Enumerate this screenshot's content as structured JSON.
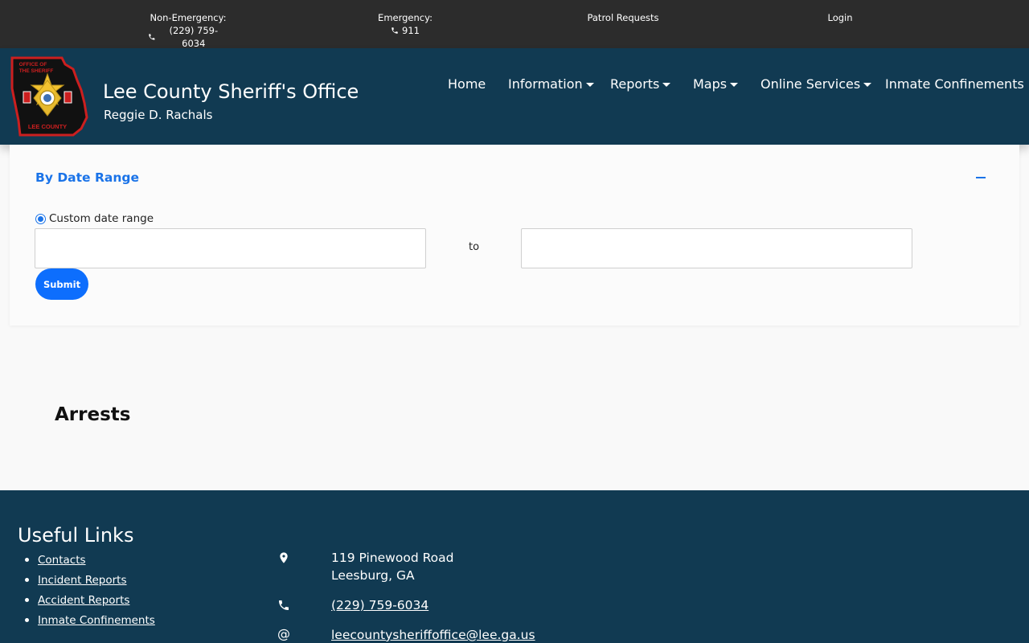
{
  "topbar": {
    "non_emergency_label": "Non-Emergency:",
    "non_emergency_phone": "(229) 759-6034",
    "emergency_label": "Emergency:",
    "emergency_phone": "911",
    "patrol_requests": "Patrol Requests",
    "login": "Login",
    "phone_icon": "phone-icon"
  },
  "header": {
    "title": "Lee County Sheriff's Office",
    "subtitle": "Reggie D. Rachals",
    "logo": {
      "icon": "sheriff-badge-logo",
      "text_top": "OFFICE OF THE SHERIFF",
      "text_bottom": "LEE COUNTY",
      "badge_text": "SHERIFF LEE COUNTY",
      "colors": {
        "outline": "#cc1f1f",
        "fill": "#111111",
        "star": "#f2c230"
      }
    },
    "nav": [
      {
        "label": "Home",
        "has_dropdown": false
      },
      {
        "label": "Information",
        "has_dropdown": true
      },
      {
        "label": "Reports",
        "has_dropdown": true
      },
      {
        "label": "Maps",
        "has_dropdown": true
      },
      {
        "label": "Online Services",
        "has_dropdown": true
      },
      {
        "label": "Inmate Confinements",
        "has_dropdown": false
      }
    ]
  },
  "filter": {
    "title": "By Date Range",
    "collapse_icon": "minus-icon",
    "radio_label": "Custom date range",
    "radio_checked": true,
    "start_date_value": "",
    "to_label": "to",
    "end_date_value": "",
    "submit_label": "Submit"
  },
  "main": {
    "section_heading": "Arrests"
  },
  "footer": {
    "title": "Useful Links",
    "links": [
      "Contacts",
      "Incident Reports",
      "Accident Reports",
      "Inmate Confinements"
    ],
    "address_line1": "119 Pinewood Road",
    "address_line2": "Leesburg, GA",
    "phone": "(229) 759-6034",
    "email_symbol": "@",
    "email": "leecountysheriffoffice@lee.ga.us",
    "icons": {
      "address": "map-pin-icon",
      "phone": "phone-icon",
      "email": "at-sign-icon"
    }
  },
  "colors": {
    "topbar_bg": "#2c2c2c",
    "header_bg": "#113a52",
    "accent_blue": "#1a73e8",
    "button_blue": "#0d6efd",
    "page_bg": "#f9f9f9"
  }
}
